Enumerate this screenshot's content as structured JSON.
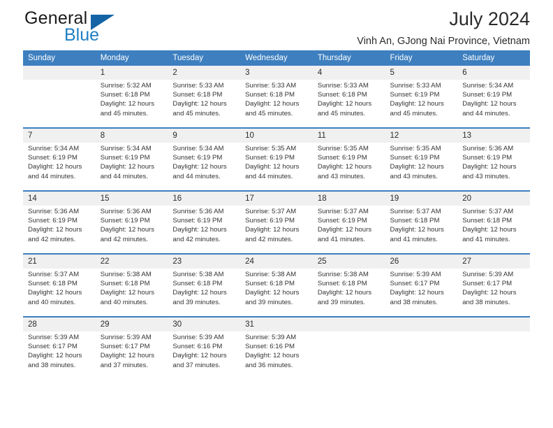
{
  "logo": {
    "word1": "General",
    "word2": "Blue",
    "triangle_color": "#1464a5",
    "blue_color": "#1f7fc4"
  },
  "header": {
    "title": "July 2024",
    "subtitle": "Vinh An, GJong Nai Province, Vietnam"
  },
  "theme": {
    "header_bg": "#3d7fbf",
    "daynum_bg": "#f0f0f0",
    "cell_bg": "#ffffff"
  },
  "weekdays": [
    "Sunday",
    "Monday",
    "Tuesday",
    "Wednesday",
    "Thursday",
    "Friday",
    "Saturday"
  ],
  "weeks": [
    {
      "days": [
        {
          "num": "",
          "sunrise": "",
          "sunset": "",
          "daylight1": "",
          "daylight2": ""
        },
        {
          "num": "1",
          "sunrise": "Sunrise: 5:32 AM",
          "sunset": "Sunset: 6:18 PM",
          "daylight1": "Daylight: 12 hours",
          "daylight2": "and 45 minutes."
        },
        {
          "num": "2",
          "sunrise": "Sunrise: 5:33 AM",
          "sunset": "Sunset: 6:18 PM",
          "daylight1": "Daylight: 12 hours",
          "daylight2": "and 45 minutes."
        },
        {
          "num": "3",
          "sunrise": "Sunrise: 5:33 AM",
          "sunset": "Sunset: 6:18 PM",
          "daylight1": "Daylight: 12 hours",
          "daylight2": "and 45 minutes."
        },
        {
          "num": "4",
          "sunrise": "Sunrise: 5:33 AM",
          "sunset": "Sunset: 6:18 PM",
          "daylight1": "Daylight: 12 hours",
          "daylight2": "and 45 minutes."
        },
        {
          "num": "5",
          "sunrise": "Sunrise: 5:33 AM",
          "sunset": "Sunset: 6:19 PM",
          "daylight1": "Daylight: 12 hours",
          "daylight2": "and 45 minutes."
        },
        {
          "num": "6",
          "sunrise": "Sunrise: 5:34 AM",
          "sunset": "Sunset: 6:19 PM",
          "daylight1": "Daylight: 12 hours",
          "daylight2": "and 44 minutes."
        }
      ]
    },
    {
      "days": [
        {
          "num": "7",
          "sunrise": "Sunrise: 5:34 AM",
          "sunset": "Sunset: 6:19 PM",
          "daylight1": "Daylight: 12 hours",
          "daylight2": "and 44 minutes."
        },
        {
          "num": "8",
          "sunrise": "Sunrise: 5:34 AM",
          "sunset": "Sunset: 6:19 PM",
          "daylight1": "Daylight: 12 hours",
          "daylight2": "and 44 minutes."
        },
        {
          "num": "9",
          "sunrise": "Sunrise: 5:34 AM",
          "sunset": "Sunset: 6:19 PM",
          "daylight1": "Daylight: 12 hours",
          "daylight2": "and 44 minutes."
        },
        {
          "num": "10",
          "sunrise": "Sunrise: 5:35 AM",
          "sunset": "Sunset: 6:19 PM",
          "daylight1": "Daylight: 12 hours",
          "daylight2": "and 44 minutes."
        },
        {
          "num": "11",
          "sunrise": "Sunrise: 5:35 AM",
          "sunset": "Sunset: 6:19 PM",
          "daylight1": "Daylight: 12 hours",
          "daylight2": "and 43 minutes."
        },
        {
          "num": "12",
          "sunrise": "Sunrise: 5:35 AM",
          "sunset": "Sunset: 6:19 PM",
          "daylight1": "Daylight: 12 hours",
          "daylight2": "and 43 minutes."
        },
        {
          "num": "13",
          "sunrise": "Sunrise: 5:36 AM",
          "sunset": "Sunset: 6:19 PM",
          "daylight1": "Daylight: 12 hours",
          "daylight2": "and 43 minutes."
        }
      ]
    },
    {
      "days": [
        {
          "num": "14",
          "sunrise": "Sunrise: 5:36 AM",
          "sunset": "Sunset: 6:19 PM",
          "daylight1": "Daylight: 12 hours",
          "daylight2": "and 42 minutes."
        },
        {
          "num": "15",
          "sunrise": "Sunrise: 5:36 AM",
          "sunset": "Sunset: 6:19 PM",
          "daylight1": "Daylight: 12 hours",
          "daylight2": "and 42 minutes."
        },
        {
          "num": "16",
          "sunrise": "Sunrise: 5:36 AM",
          "sunset": "Sunset: 6:19 PM",
          "daylight1": "Daylight: 12 hours",
          "daylight2": "and 42 minutes."
        },
        {
          "num": "17",
          "sunrise": "Sunrise: 5:37 AM",
          "sunset": "Sunset: 6:19 PM",
          "daylight1": "Daylight: 12 hours",
          "daylight2": "and 42 minutes."
        },
        {
          "num": "18",
          "sunrise": "Sunrise: 5:37 AM",
          "sunset": "Sunset: 6:19 PM",
          "daylight1": "Daylight: 12 hours",
          "daylight2": "and 41 minutes."
        },
        {
          "num": "19",
          "sunrise": "Sunrise: 5:37 AM",
          "sunset": "Sunset: 6:18 PM",
          "daylight1": "Daylight: 12 hours",
          "daylight2": "and 41 minutes."
        },
        {
          "num": "20",
          "sunrise": "Sunrise: 5:37 AM",
          "sunset": "Sunset: 6:18 PM",
          "daylight1": "Daylight: 12 hours",
          "daylight2": "and 41 minutes."
        }
      ]
    },
    {
      "days": [
        {
          "num": "21",
          "sunrise": "Sunrise: 5:37 AM",
          "sunset": "Sunset: 6:18 PM",
          "daylight1": "Daylight: 12 hours",
          "daylight2": "and 40 minutes."
        },
        {
          "num": "22",
          "sunrise": "Sunrise: 5:38 AM",
          "sunset": "Sunset: 6:18 PM",
          "daylight1": "Daylight: 12 hours",
          "daylight2": "and 40 minutes."
        },
        {
          "num": "23",
          "sunrise": "Sunrise: 5:38 AM",
          "sunset": "Sunset: 6:18 PM",
          "daylight1": "Daylight: 12 hours",
          "daylight2": "and 39 minutes."
        },
        {
          "num": "24",
          "sunrise": "Sunrise: 5:38 AM",
          "sunset": "Sunset: 6:18 PM",
          "daylight1": "Daylight: 12 hours",
          "daylight2": "and 39 minutes."
        },
        {
          "num": "25",
          "sunrise": "Sunrise: 5:38 AM",
          "sunset": "Sunset: 6:18 PM",
          "daylight1": "Daylight: 12 hours",
          "daylight2": "and 39 minutes."
        },
        {
          "num": "26",
          "sunrise": "Sunrise: 5:39 AM",
          "sunset": "Sunset: 6:17 PM",
          "daylight1": "Daylight: 12 hours",
          "daylight2": "and 38 minutes."
        },
        {
          "num": "27",
          "sunrise": "Sunrise: 5:39 AM",
          "sunset": "Sunset: 6:17 PM",
          "daylight1": "Daylight: 12 hours",
          "daylight2": "and 38 minutes."
        }
      ]
    },
    {
      "days": [
        {
          "num": "28",
          "sunrise": "Sunrise: 5:39 AM",
          "sunset": "Sunset: 6:17 PM",
          "daylight1": "Daylight: 12 hours",
          "daylight2": "and 38 minutes."
        },
        {
          "num": "29",
          "sunrise": "Sunrise: 5:39 AM",
          "sunset": "Sunset: 6:17 PM",
          "daylight1": "Daylight: 12 hours",
          "daylight2": "and 37 minutes."
        },
        {
          "num": "30",
          "sunrise": "Sunrise: 5:39 AM",
          "sunset": "Sunset: 6:16 PM",
          "daylight1": "Daylight: 12 hours",
          "daylight2": "and 37 minutes."
        },
        {
          "num": "31",
          "sunrise": "Sunrise: 5:39 AM",
          "sunset": "Sunset: 6:16 PM",
          "daylight1": "Daylight: 12 hours",
          "daylight2": "and 36 minutes."
        },
        {
          "num": "",
          "sunrise": "",
          "sunset": "",
          "daylight1": "",
          "daylight2": ""
        },
        {
          "num": "",
          "sunrise": "",
          "sunset": "",
          "daylight1": "",
          "daylight2": ""
        },
        {
          "num": "",
          "sunrise": "",
          "sunset": "",
          "daylight1": "",
          "daylight2": ""
        }
      ]
    }
  ]
}
